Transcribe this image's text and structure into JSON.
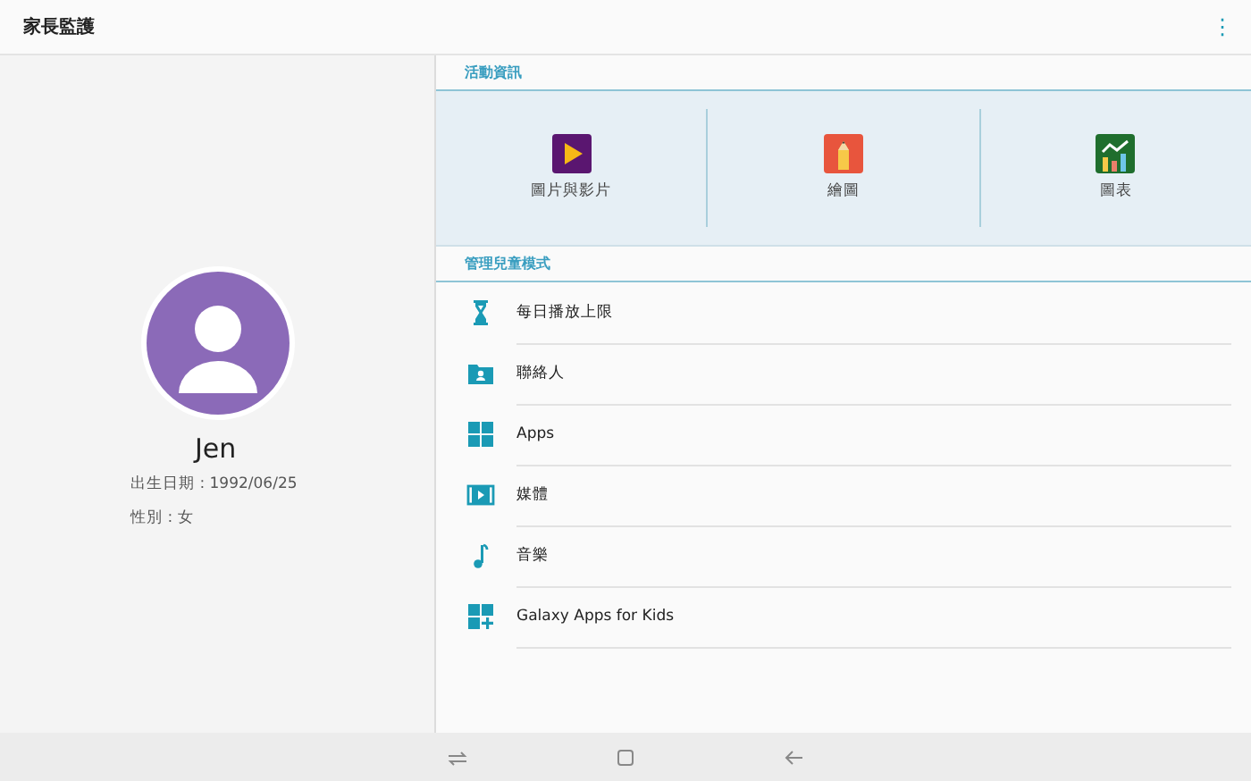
{
  "app_bar": {
    "title": "家長監護",
    "menu": "⋮"
  },
  "profile": {
    "name": "Jen",
    "birthday": "出生日期 : 1992/06/25",
    "gender": "性別 : 女"
  },
  "activity": {
    "header": "活動資訊",
    "items": [
      {
        "label": "圖片與影片",
        "kind": "video"
      },
      {
        "label": "繪圖",
        "kind": "drawing"
      },
      {
        "label": "圖表",
        "kind": "chart"
      }
    ]
  },
  "manage": {
    "header": "管理兒童模式",
    "items": [
      {
        "label": "每日播放上限",
        "kind": "timer"
      },
      {
        "label": "聯絡人",
        "kind": "contacts"
      },
      {
        "label": "Apps",
        "kind": "apps"
      },
      {
        "label": "媒體",
        "kind": "media"
      },
      {
        "label": "音樂",
        "kind": "music"
      },
      {
        "label": "Galaxy Apps for Kids",
        "kind": "store"
      }
    ]
  },
  "nav_bar": {
    "buttons": [
      {
        "kind": "recent"
      },
      {
        "kind": "home"
      },
      {
        "kind": "back"
      }
    ]
  }
}
